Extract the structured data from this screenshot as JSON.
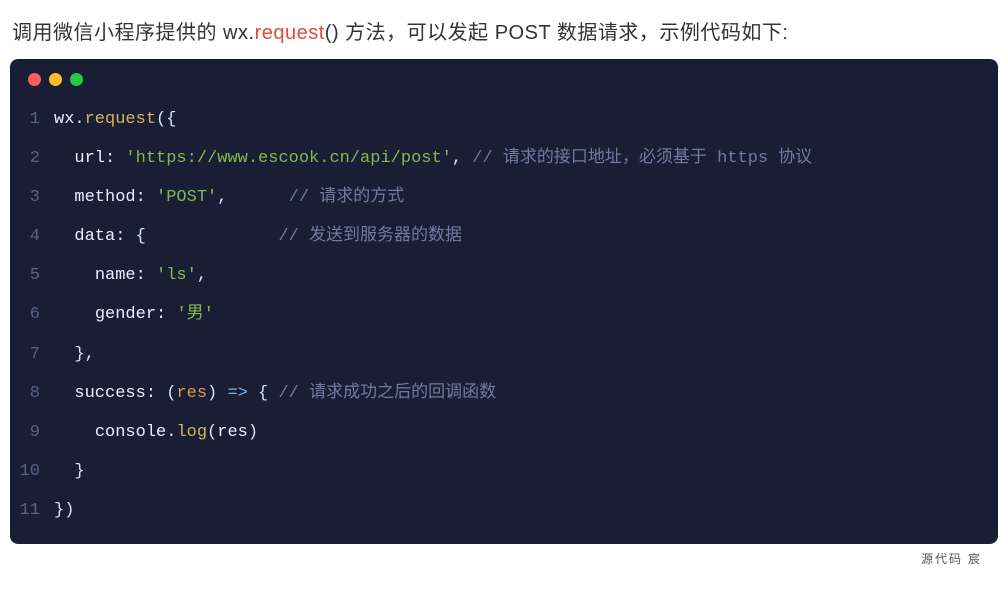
{
  "intro": {
    "prefix": "调用微信小程序提供的 wx.",
    "red": "request",
    "suffix": "() 方法，可以发起 POST 数据请求，示例代码如下:"
  },
  "code": {
    "lines": [
      {
        "num": "1",
        "segments": [
          {
            "cls": "c-ident",
            "text": "wx"
          },
          {
            "cls": "c-punct",
            "text": "."
          },
          {
            "cls": "c-func",
            "text": "request"
          },
          {
            "cls": "c-punct",
            "text": "({"
          }
        ]
      },
      {
        "num": "2",
        "segments": [
          {
            "cls": "c-punct",
            "text": "  "
          },
          {
            "cls": "c-attr",
            "text": "url"
          },
          {
            "cls": "c-punct",
            "text": ": "
          },
          {
            "cls": "c-string",
            "text": "'https://www.escook.cn/api/post'"
          },
          {
            "cls": "c-punct",
            "text": ", "
          },
          {
            "cls": "c-comment",
            "text": "// 请求的接口地址，必须基于 https 协议"
          }
        ]
      },
      {
        "num": "3",
        "segments": [
          {
            "cls": "c-punct",
            "text": "  "
          },
          {
            "cls": "c-attr",
            "text": "method"
          },
          {
            "cls": "c-punct",
            "text": ": "
          },
          {
            "cls": "c-string",
            "text": "'POST'"
          },
          {
            "cls": "c-punct",
            "text": ",      "
          },
          {
            "cls": "c-comment",
            "text": "// 请求的方式"
          }
        ]
      },
      {
        "num": "4",
        "segments": [
          {
            "cls": "c-punct",
            "text": "  "
          },
          {
            "cls": "c-attr",
            "text": "data"
          },
          {
            "cls": "c-punct",
            "text": ": {             "
          },
          {
            "cls": "c-comment",
            "text": "// 发送到服务器的数据"
          }
        ]
      },
      {
        "num": "5",
        "segments": [
          {
            "cls": "c-punct",
            "text": "    "
          },
          {
            "cls": "c-attr",
            "text": "name"
          },
          {
            "cls": "c-punct",
            "text": ": "
          },
          {
            "cls": "c-string",
            "text": "'ls'"
          },
          {
            "cls": "c-punct",
            "text": ","
          }
        ]
      },
      {
        "num": "6",
        "segments": [
          {
            "cls": "c-punct",
            "text": "    "
          },
          {
            "cls": "c-attr",
            "text": "gender"
          },
          {
            "cls": "c-punct",
            "text": ": "
          },
          {
            "cls": "c-string",
            "text": "'男'"
          }
        ]
      },
      {
        "num": "7",
        "segments": [
          {
            "cls": "c-punct",
            "text": "  },"
          }
        ]
      },
      {
        "num": "8",
        "segments": [
          {
            "cls": "c-punct",
            "text": "  "
          },
          {
            "cls": "c-attr",
            "text": "success"
          },
          {
            "cls": "c-punct",
            "text": ": ("
          },
          {
            "cls": "c-param",
            "text": "res"
          },
          {
            "cls": "c-punct",
            "text": ") "
          },
          {
            "cls": "c-arrow",
            "text": "=>"
          },
          {
            "cls": "c-punct",
            "text": " { "
          },
          {
            "cls": "c-comment",
            "text": "// 请求成功之后的回调函数"
          }
        ]
      },
      {
        "num": "9",
        "segments": [
          {
            "cls": "c-punct",
            "text": "    "
          },
          {
            "cls": "c-ident",
            "text": "console"
          },
          {
            "cls": "c-punct",
            "text": "."
          },
          {
            "cls": "c-func",
            "text": "log"
          },
          {
            "cls": "c-punct",
            "text": "("
          },
          {
            "cls": "c-ident",
            "text": "res"
          },
          {
            "cls": "c-punct",
            "text": ")"
          }
        ]
      },
      {
        "num": "10",
        "segments": [
          {
            "cls": "c-punct",
            "text": "  }"
          }
        ]
      },
      {
        "num": "11",
        "segments": [
          {
            "cls": "c-punct",
            "text": "})"
          }
        ]
      }
    ]
  },
  "footer": "源代码  宸"
}
